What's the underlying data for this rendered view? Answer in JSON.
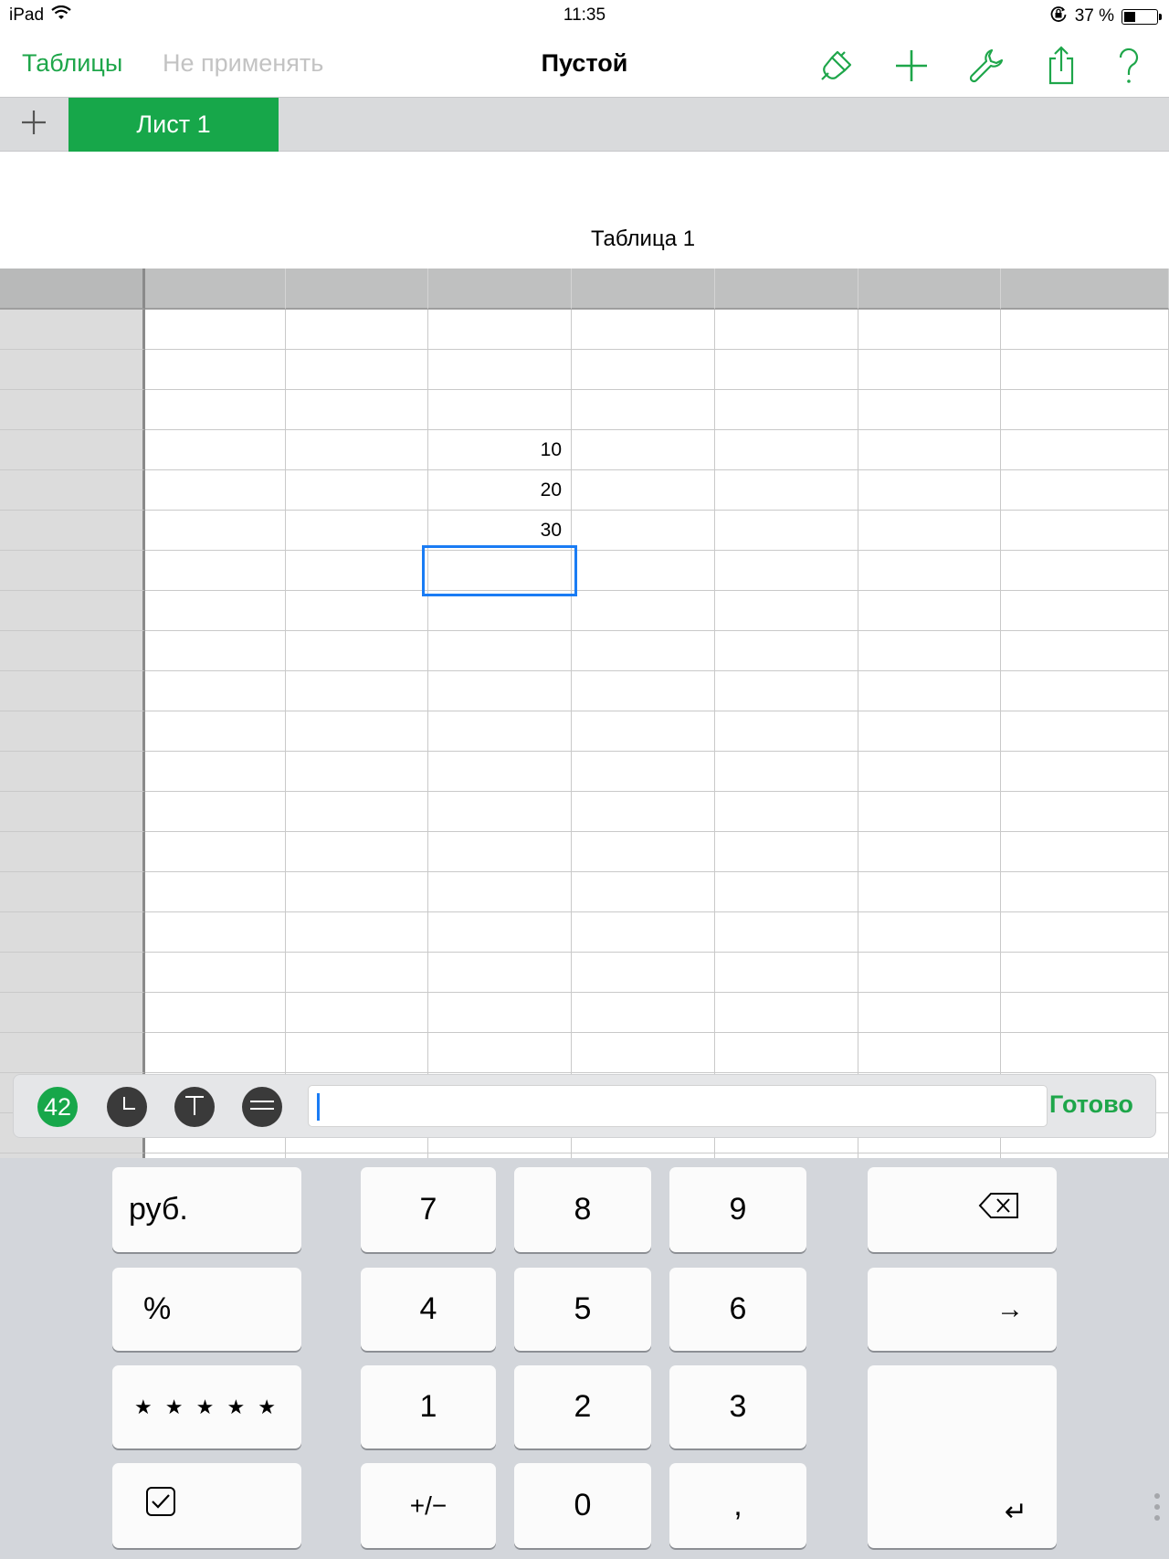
{
  "status_bar": {
    "device": "iPad",
    "time": "11:35",
    "battery": "37 %",
    "battery_fraction": 0.37,
    "icons": [
      "wifi-icon",
      "rotation-lock-icon",
      "battery-icon"
    ]
  },
  "nav": {
    "back_label": "Таблицы",
    "undo_label": "Не применять",
    "title": "Пустой",
    "tools": [
      "format-brush-icon",
      "plus-icon",
      "wrench-icon",
      "share-icon",
      "help-icon"
    ],
    "accent": "#1ea64a"
  },
  "sheets": {
    "add_icon": "plus-icon",
    "active_tab": "Лист 1",
    "active_color": "#17a74a"
  },
  "table": {
    "title": "Таблица 1",
    "cells": [
      {
        "row": 4,
        "col": 3,
        "value": "10"
      },
      {
        "row": 5,
        "col": 3,
        "value": "20"
      },
      {
        "row": 6,
        "col": 3,
        "value": "30"
      }
    ],
    "selected": {
      "row": 7,
      "col": 3
    }
  },
  "input_bar": {
    "format_buttons": [
      "42",
      "clock-icon",
      "text-icon",
      "equals-icon"
    ],
    "value": "",
    "done_label": "Готово"
  },
  "keyboard": {
    "currency": "руб.",
    "percent": "%",
    "stars": "★ ★ ★ ★ ★",
    "checkbox_icon": "checkbox-icon",
    "digits": {
      "k7": "7",
      "k8": "8",
      "k9": "9",
      "k4": "4",
      "k5": "5",
      "k6": "6",
      "k1": "1",
      "k2": "2",
      "k3": "3",
      "plusminus": "+/−",
      "k0": "0",
      "comma": ","
    },
    "backspace_icon": "backspace-icon",
    "next": "→",
    "return": "↵"
  }
}
